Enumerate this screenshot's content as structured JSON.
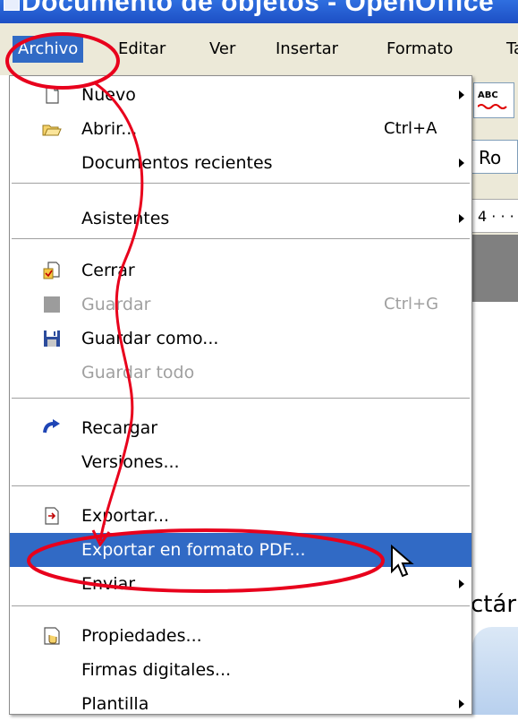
{
  "window": {
    "title": "Documento de objetos - OpenOffice"
  },
  "menubar": {
    "items": [
      {
        "label": "Archivo",
        "active": true
      },
      {
        "label": "Editar"
      },
      {
        "label": "Ver"
      },
      {
        "label": "Insertar"
      },
      {
        "label": "Formato"
      },
      {
        "label": "Ta"
      }
    ]
  },
  "background": {
    "spell_button_text": "ABC",
    "font_box_text": "Ro",
    "ruler_text": "4 · · ·",
    "page_text": "ctár"
  },
  "file_menu": {
    "items": [
      {
        "label": "Nuevo",
        "icon": "new-document-icon",
        "submenu": true
      },
      {
        "label": "Abrir...",
        "icon": "open-folder-icon",
        "shortcut": "Ctrl+A"
      },
      {
        "label": "Documentos recientes",
        "submenu": true
      },
      {
        "label": "Asistentes",
        "submenu": true
      },
      {
        "label": "Cerrar",
        "icon": "close-document-icon"
      },
      {
        "label": "Guardar",
        "icon": "save-icon",
        "shortcut": "Ctrl+G",
        "disabled": true
      },
      {
        "label": "Guardar como...",
        "icon": "floppy-disk-icon"
      },
      {
        "label": "Guardar todo",
        "disabled": true
      },
      {
        "label": "Recargar",
        "icon": "reload-icon"
      },
      {
        "label": "Versiones..."
      },
      {
        "label": "Exportar...",
        "icon": "export-icon"
      },
      {
        "label": "Exportar en formato PDF...",
        "highlighted": true
      },
      {
        "label": "Enviar",
        "submenu": true
      },
      {
        "label": "Propiedades...",
        "icon": "properties-icon"
      },
      {
        "label": "Firmas digitales..."
      },
      {
        "label": "Plantilla",
        "submenu": true
      }
    ]
  },
  "annotation": {
    "color": "#e8001c"
  },
  "colors": {
    "highlight": "#316ac5",
    "menubar": "#ece9d8",
    "titlebar": "#2458d4"
  }
}
